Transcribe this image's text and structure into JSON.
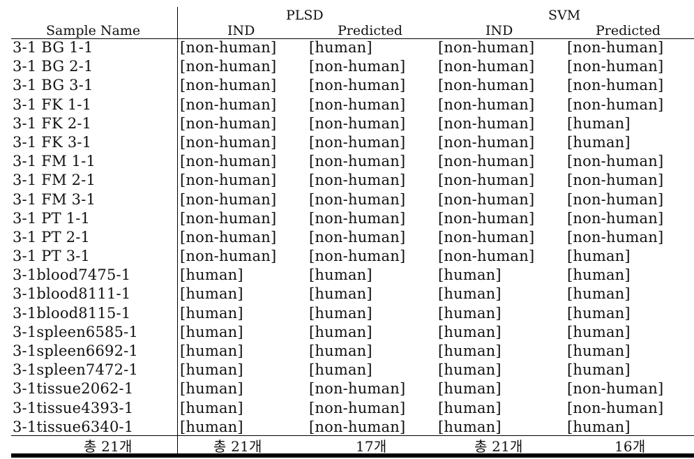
{
  "header": {
    "group_plsd": "PLSD",
    "group_svm": "SVM",
    "sample_name": "Sample Name",
    "plsd_ind": "IND",
    "plsd_pred": "Predicted",
    "svm_ind": "IND",
    "svm_pred": "Predicted"
  },
  "rows": [
    {
      "name": "3-1 BG 1-1",
      "plsd_ind": "[non-human]",
      "plsd_pred": "[human]",
      "svm_ind": "[non-human]",
      "svm_pred": "[non-human]"
    },
    {
      "name": "3-1 BG 2-1",
      "plsd_ind": "[non-human]",
      "plsd_pred": "[non-human]",
      "svm_ind": "[non-human]",
      "svm_pred": "[non-human]"
    },
    {
      "name": "3-1 BG 3-1",
      "plsd_ind": "[non-human]",
      "plsd_pred": "[non-human]",
      "svm_ind": "[non-human]",
      "svm_pred": "[non-human]"
    },
    {
      "name": "3-1 FK 1-1",
      "plsd_ind": "[non-human]",
      "plsd_pred": "[non-human]",
      "svm_ind": "[non-human]",
      "svm_pred": "[non-human]"
    },
    {
      "name": "3-1 FK 2-1",
      "plsd_ind": "[non-human]",
      "plsd_pred": "[non-human]",
      "svm_ind": "[non-human]",
      "svm_pred": "[human]"
    },
    {
      "name": "3-1 FK 3-1",
      "plsd_ind": "[non-human]",
      "plsd_pred": "[non-human]",
      "svm_ind": "[non-human]",
      "svm_pred": "[human]"
    },
    {
      "name": "3-1 FM 1-1",
      "plsd_ind": "[non-human]",
      "plsd_pred": "[non-human]",
      "svm_ind": "[non-human]",
      "svm_pred": "[non-human]"
    },
    {
      "name": "3-1 FM 2-1",
      "plsd_ind": "[non-human]",
      "plsd_pred": "[non-human]",
      "svm_ind": "[non-human]",
      "svm_pred": "[non-human]"
    },
    {
      "name": "3-1 FM 3-1",
      "plsd_ind": "[non-human]",
      "plsd_pred": "[non-human]",
      "svm_ind": "[non-human]",
      "svm_pred": "[non-human]"
    },
    {
      "name": "3-1 PT 1-1",
      "plsd_ind": "[non-human]",
      "plsd_pred": "[non-human]",
      "svm_ind": "[non-human]",
      "svm_pred": "[non-human]"
    },
    {
      "name": "3-1 PT 2-1",
      "plsd_ind": "[non-human]",
      "plsd_pred": "[non-human]",
      "svm_ind": "[non-human]",
      "svm_pred": "[non-human]"
    },
    {
      "name": "3-1 PT 3-1",
      "plsd_ind": "[non-human]",
      "plsd_pred": "[non-human]",
      "svm_ind": "[non-human]",
      "svm_pred": "[human]"
    },
    {
      "name": "3-1blood7475-1",
      "plsd_ind": "[human]",
      "plsd_pred": "[human]",
      "svm_ind": "[human]",
      "svm_pred": "[human]"
    },
    {
      "name": "3-1blood8111-1",
      "plsd_ind": "[human]",
      "plsd_pred": "[human]",
      "svm_ind": "[human]",
      "svm_pred": "[human]"
    },
    {
      "name": "3-1blood8115-1",
      "plsd_ind": "[human]",
      "plsd_pred": "[human]",
      "svm_ind": "[human]",
      "svm_pred": "[human]"
    },
    {
      "name": "3-1spleen6585-1",
      "plsd_ind": "[human]",
      "plsd_pred": "[human]",
      "svm_ind": "[human]",
      "svm_pred": "[human]"
    },
    {
      "name": "3-1spleen6692-1",
      "plsd_ind": "[human]",
      "plsd_pred": "[human]",
      "svm_ind": "[human]",
      "svm_pred": "[human]"
    },
    {
      "name": "3-1spleen7472-1",
      "plsd_ind": "[human]",
      "plsd_pred": "[human]",
      "svm_ind": "[human]",
      "svm_pred": "[human]"
    },
    {
      "name": "3-1tissue2062-1",
      "plsd_ind": "[human]",
      "plsd_pred": "[non-human]",
      "svm_ind": "[human]",
      "svm_pred": "[non-human]"
    },
    {
      "name": "3-1tissue4393-1",
      "plsd_ind": "[human]",
      "plsd_pred": "[non-human]",
      "svm_ind": "[human]",
      "svm_pred": "[non-human]"
    },
    {
      "name": "3-1tissue6340-1",
      "plsd_ind": "[human]",
      "plsd_pred": "[non-human]",
      "svm_ind": "[human]",
      "svm_pred": "[human]"
    }
  ],
  "footer": {
    "total_samples": "총 21개",
    "plsd_ind_total": "총 21개",
    "plsd_pred_correct": "17개",
    "svm_ind_total": "총 21개",
    "svm_pred_correct": "16개"
  }
}
